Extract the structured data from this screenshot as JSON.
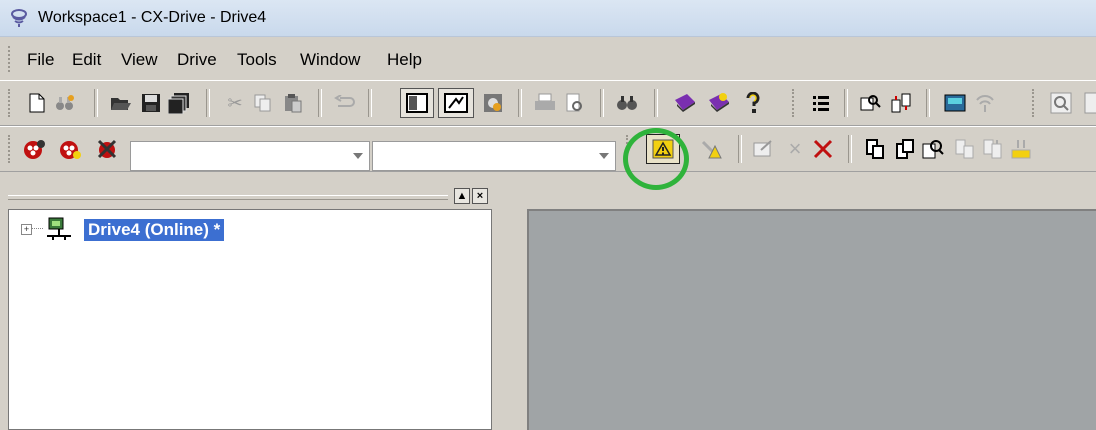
{
  "window": {
    "title": "Workspace1 - CX-Drive - Drive4"
  },
  "menu": {
    "file": "File",
    "edit": "Edit",
    "view": "View",
    "drive": "Drive",
    "tools": "Tools",
    "window": "Window",
    "help": "Help"
  },
  "tree": {
    "item_label": "Drive4 (Online) *",
    "expander": "+"
  },
  "combo1": {
    "value": ""
  },
  "combo2": {
    "value": ""
  },
  "icons": {
    "toolbar1": [
      "new-document-icon",
      "binoculars-icon",
      "open-folder-icon",
      "save-icon",
      "save-all-icon",
      "cut-icon",
      "copy-icon",
      "paste-icon",
      "undo-icon",
      "layout-icon",
      "zoom-window-icon",
      "settings-icon",
      "print-icon",
      "print-preview-icon",
      "find-icon",
      "book-icon",
      "book-star-icon",
      "help-icon",
      "list-icon",
      "monitor-icon",
      "transfer-icon",
      "calculator-icon",
      "wifi-icon",
      "search-icon"
    ],
    "toolbar2": [
      "connect-icon",
      "disconnect-icon",
      "stop-icon",
      "warning-icon",
      "tune-icon",
      "edit-icon",
      "close-icon",
      "delete-icon",
      "download-icon",
      "upload-icon",
      "compare-icon",
      "view-icon",
      "import-icon",
      "export-icon"
    ]
  },
  "colors": {
    "highlight": "#2fb33b",
    "selection": "#3c6fd1",
    "workspace": "#a0a4a6"
  }
}
